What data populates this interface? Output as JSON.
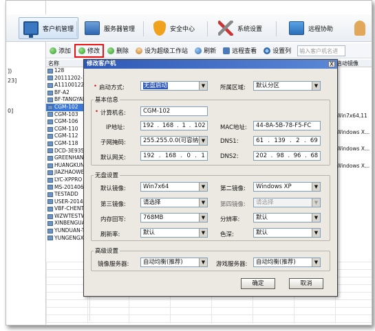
{
  "toolbar": {
    "items": [
      {
        "label": "客户机管理",
        "icon": "monitor-icon"
      },
      {
        "label": "服务器管理",
        "icon": "server-icon"
      },
      {
        "label": "安全中心",
        "icon": "shield-icon"
      },
      {
        "label": "系统设置",
        "icon": "tools-icon"
      },
      {
        "label": "远程协助",
        "icon": "remote-icon"
      }
    ]
  },
  "left_panel": {
    "fragments": [
      "])",
      "23]",
      "0]"
    ]
  },
  "actions": {
    "add": "添加",
    "edit": "修改",
    "delete": "删除",
    "set_super": "设为超级工作站",
    "refresh": "刷新",
    "remote_view": "远程查看",
    "set_columns": "设置列",
    "search_placeholder": "输入客户机名进"
  },
  "list": {
    "header": "名称",
    "rows": [
      "128",
      "20111202-1",
      "A11100122",
      "BF-A2",
      "BF-TANGYAI",
      "CGM-102",
      "CGM-103",
      "CGM-106",
      "CGM-110",
      "CGM-112",
      "CGM-118",
      "DCD-3E935E",
      "GREENHAND",
      "HUANGKUN",
      "JIAZHAOWE",
      "LYC-XPPRO",
      "MS-2014061",
      "TESTADD",
      "USER-2014C",
      "VBF-CHENTA",
      "WZWTESTW",
      "XINBENGUAI",
      "YUNDUAN-T",
      "YUNGENGXII"
    ],
    "selected_index": 5
  },
  "right_column": {
    "header": "启动镜像",
    "cells": [
      "Win7x64,11",
      "Windows X...",
      "Windows X...",
      "Windows X..."
    ]
  },
  "dialog": {
    "title": "修改客户机",
    "close": "X",
    "boot_mode_label": "启动方式:",
    "boot_mode_value": "无盘启动",
    "zone_label": "所属区域:",
    "zone_value": "默认分区",
    "basic_info": "基本信息",
    "computer_name_label": "计算机名:",
    "computer_name_value": "CGM-102",
    "ip_label": "IP地址:",
    "ip_value": [
      "192",
      "168",
      "1",
      "102"
    ],
    "mac_label": "MAC地址:",
    "mac_value": "44-8A-5B-78-F5-FC",
    "subnet_label": "子网掩码:",
    "subnet_value": "255.255.0.0(可容纳65",
    "dns1_label": "DNS1:",
    "dns1_value": [
      "61",
      "139",
      "2",
      "69"
    ],
    "gateway_label": "默认网关:",
    "gateway_value": [
      "192",
      "168",
      "0",
      "1"
    ],
    "dns2_label": "DNS2:",
    "dns2_value": [
      "202",
      "98",
      "96",
      "68"
    ],
    "diskless": "无盘设置",
    "default_image_label": "默认镜像:",
    "default_image_value": "Win7x64",
    "second_image_label": "第二镜像:",
    "second_image_value": "Windows XP",
    "third_image_label": "第三镜像:",
    "third_image_value": "请选择",
    "fourth_image_label": "第四镜像:",
    "fourth_image_value": "请选择",
    "memory_label": "内存回写:",
    "memory_value": "768MB",
    "resolution_label": "分辨率:",
    "resolution_value": "默认",
    "refresh_label": "刷新率:",
    "refresh_value": "默认",
    "color_label": "色深:",
    "color_value": "默认",
    "advanced": "高级设置",
    "image_server_label": "镜像服务器:",
    "image_server_value": "自动均衡(推荐)",
    "game_server_label": "游戏服务器:",
    "game_server_value": "自动均衡(推荐)",
    "ok": "确定",
    "cancel": "取消"
  }
}
